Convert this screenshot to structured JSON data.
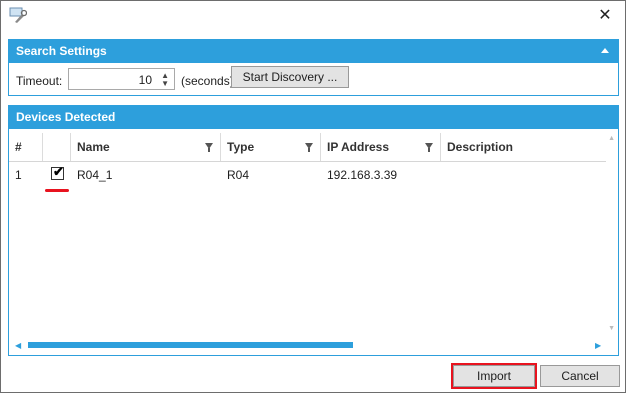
{
  "window": {
    "close_symbol": "✕",
    "icon": "wrench-icon"
  },
  "search_settings": {
    "title": "Search Settings",
    "timeout_label": "Timeout:",
    "timeout_value": "10",
    "seconds_label": "(seconds)",
    "start_discovery_label": "Start Discovery ..."
  },
  "devices": {
    "title": "Devices Detected",
    "columns": [
      "#",
      "Name",
      "Type",
      "IP Address",
      "Description"
    ],
    "rows": [
      {
        "index": "1",
        "checked": true,
        "name": "R04_1",
        "type": "R04",
        "ip": "192.168.3.39",
        "description": ""
      }
    ]
  },
  "footer": {
    "import_label": "Import",
    "cancel_label": "Cancel"
  },
  "colors": {
    "accent": "#2d9fdc",
    "highlight": "#e8131f"
  }
}
